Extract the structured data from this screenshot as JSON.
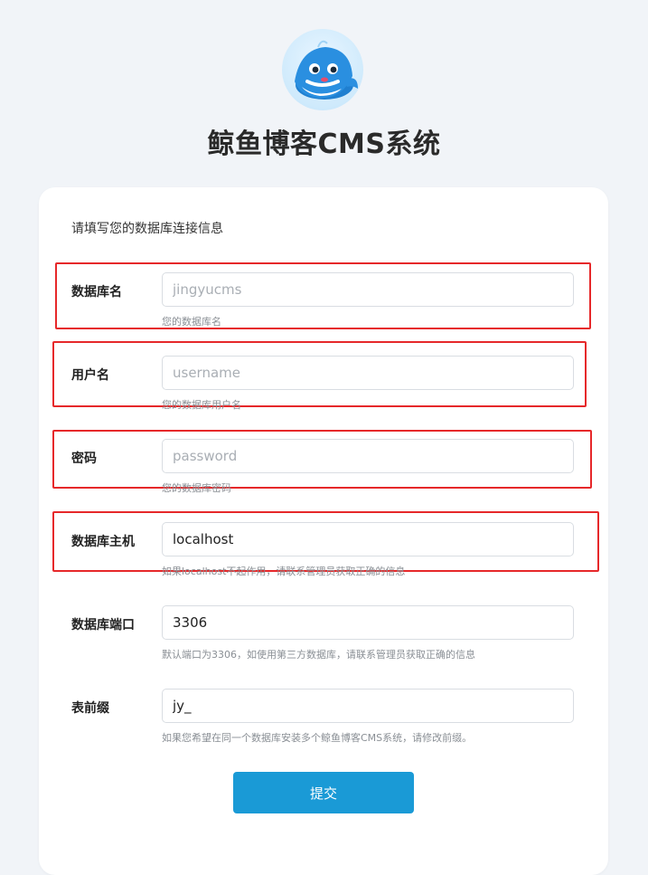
{
  "header": {
    "logo_icon": "whale-logo-icon",
    "title": "鲸鱼博客CMS系统"
  },
  "form": {
    "intro": "请填写您的数据库连接信息",
    "fields": [
      {
        "label": "数据库名",
        "value": "",
        "placeholder": "jingyucms",
        "help": "您的数据库名",
        "highlighted": true
      },
      {
        "label": "用户名",
        "value": "",
        "placeholder": "username",
        "help": "您的数据库用户名",
        "highlighted": true
      },
      {
        "label": "密码",
        "value": "",
        "placeholder": "password",
        "help": "您的数据库密码",
        "highlighted": true
      },
      {
        "label": "数据库主机",
        "value": "localhost",
        "placeholder": "",
        "help": "如果localhost不起作用，请联系管理员获取正确的信息",
        "highlighted": true
      },
      {
        "label": "数据库端口",
        "value": "3306",
        "placeholder": "",
        "help": "默认端口为3306，如使用第三方数据库，请联系管理员获取正确的信息",
        "highlighted": false
      },
      {
        "label": "表前缀",
        "value": "jy_",
        "placeholder": "",
        "help": "如果您希望在同一个数据库安装多个鲸鱼博客CMS系统，请修改前缀。",
        "highlighted": false
      }
    ],
    "submit_label": "提交"
  },
  "colors": {
    "accent": "#1a9ad6",
    "highlight": "#e6282a",
    "background": "#f1f4f8"
  }
}
